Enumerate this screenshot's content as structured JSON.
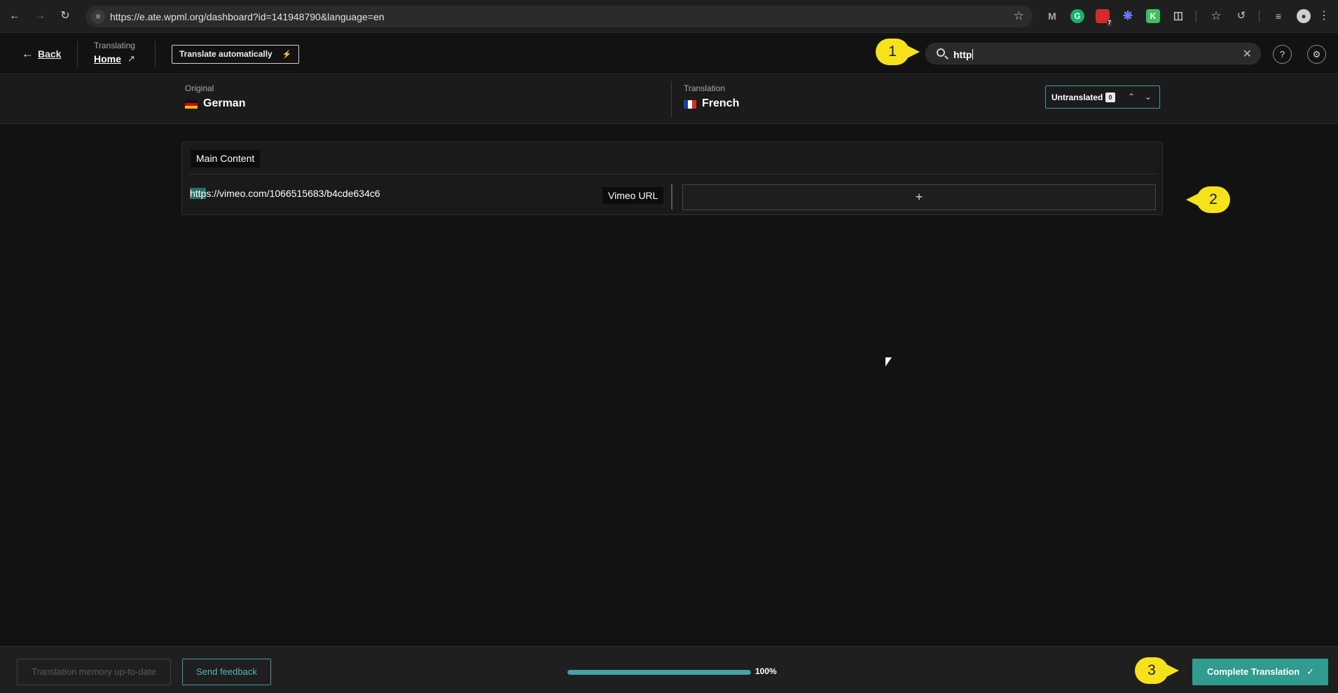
{
  "browser": {
    "url": "https://e.ate.wpml.org/dashboard?id=141948790&language=en",
    "extension_badge": "7"
  },
  "header": {
    "back_label": "Back",
    "translating_label": "Translating",
    "page_name": "Home",
    "translate_auto_label": "Translate automatically",
    "search_value": "http"
  },
  "languages": {
    "original_label": "Original",
    "original_name": "German",
    "translation_label": "Translation",
    "translation_name": "French",
    "untranslated_label": "Untranslated",
    "untranslated_count": "0"
  },
  "content": {
    "section_title": "Main Content",
    "rows": [
      {
        "source_highlight": "http",
        "source_rest": "s://vimeo.com/1066515683/b4cde634c6",
        "field_type": "Vimeo URL",
        "add_label": "+"
      }
    ]
  },
  "annotations": {
    "callout_1": "1",
    "callout_2": "2",
    "callout_3": "3"
  },
  "footer": {
    "tm_label": "Translation memory up-to-date",
    "feedback_label": "Send feedback",
    "progress_value": 100,
    "progress_text": "100%",
    "complete_label": "Complete Translation"
  },
  "colors": {
    "accent": "#2f9c8f",
    "outline_accent": "#3e9aa3",
    "callout": "#f6e21a",
    "background": "#121212"
  }
}
